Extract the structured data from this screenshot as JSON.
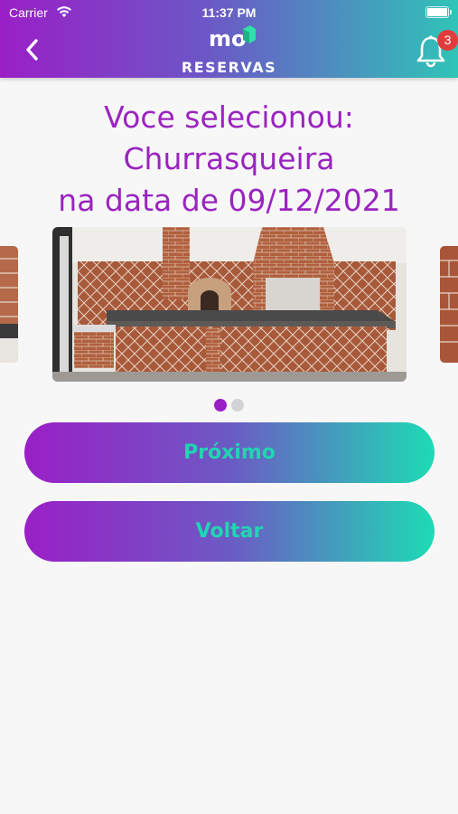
{
  "status_bar": {
    "carrier": "Carrier",
    "time": "11:37 PM"
  },
  "header": {
    "title": "RESERVAS",
    "logo_text": "mo",
    "notification_count": "3"
  },
  "selection": {
    "line1": "Voce selecionou:",
    "line2": "Churrasqueira",
    "line3": "na data de 09/12/2021"
  },
  "carousel": {
    "active_index": 0,
    "total": 2
  },
  "buttons": {
    "next_label": "Próximo",
    "back_label": "Voltar"
  },
  "colors": {
    "primary_purple": "#9a1fc6",
    "accent_teal": "#1fd6b2",
    "badge_red": "#e03c3c",
    "heading_purple": "#9a24bf"
  },
  "icons": {
    "back": "chevron-left-icon",
    "notification": "bell-icon",
    "wifi": "wifi-icon",
    "battery": "battery-icon"
  }
}
